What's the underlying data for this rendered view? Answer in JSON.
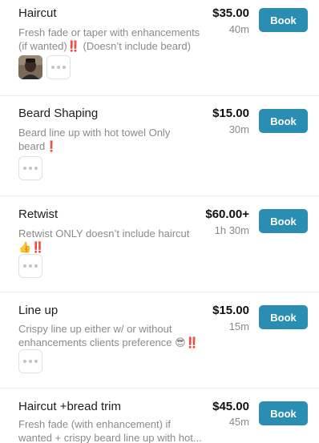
{
  "colors": {
    "book_button_bg": "#2a8eb3",
    "book_button_text": "#ffffff",
    "price_text": "#111111",
    "description_text": "#8a8a8a"
  },
  "services": [
    {
      "name": "Haircut",
      "description": "Fresh fade or taper with enhancements (if wanted)‼️ (Doesn’t include beard)",
      "price": "$35.00",
      "duration": "40m",
      "book_label": "Book",
      "has_thumbnail": true,
      "more_icon": "ellipsis-icon"
    },
    {
      "name": "Beard Shaping",
      "description": "Beard line up with hot towel  Only beard❗",
      "price": "$15.00",
      "duration": "30m",
      "book_label": "Book",
      "has_thumbnail": false,
      "more_icon": "ellipsis-icon"
    },
    {
      "name": "Retwist",
      "description": "Retwist ONLY doesn’t include haircut 👍‼️",
      "price": "$60.00+",
      "duration": "1h 30m",
      "book_label": "Book",
      "has_thumbnail": false,
      "more_icon": "ellipsis-icon"
    },
    {
      "name": "Line up",
      "description": "Crispy line up either w/ or without enhancements clients preference 😎‼️",
      "price": "$15.00",
      "duration": "15m",
      "book_label": "Book",
      "has_thumbnail": false,
      "more_icon": "ellipsis-icon"
    },
    {
      "name": "Haircut +bread trim",
      "description": "Fresh fade (with enhancement) if wanted + crispy beard line up with hot...",
      "price": "$45.00",
      "duration": "45m",
      "book_label": "Book",
      "has_thumbnail": false,
      "more_icon": "ellipsis-icon"
    }
  ]
}
